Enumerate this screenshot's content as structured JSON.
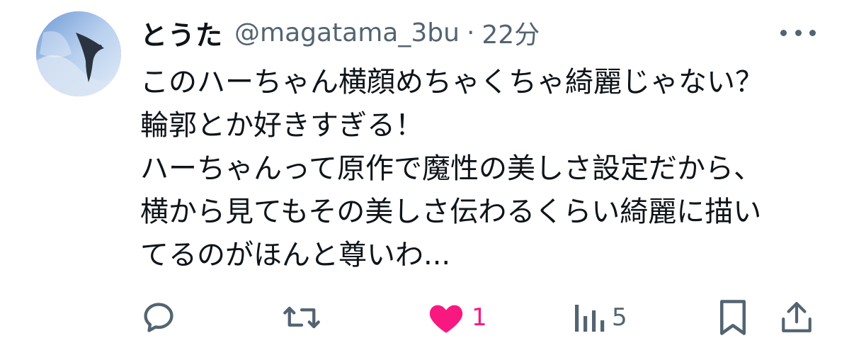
{
  "tweet": {
    "author": {
      "display_name": "とうた",
      "handle": "@magatama_3bu"
    },
    "separator": "·",
    "timestamp": "22分",
    "text_lines": [
      "このハーちゃん横顔めちゃくちゃ綺麗じゃない？",
      "輪郭とか好きすぎる！",
      "ハーちゃんって原作で魔性の美しさ設定だから、",
      "横から見てもその美しさ伝わるくらい綺麗に描い",
      "てるのがほんと尊いわ..."
    ],
    "actions": {
      "reply": {
        "icon": "reply-icon"
      },
      "retweet": {
        "icon": "retweet-icon"
      },
      "like": {
        "icon": "heart-icon",
        "count": "1",
        "liked": true
      },
      "views": {
        "icon": "views-icon",
        "count": "5"
      },
      "bookmark": {
        "icon": "bookmark-icon"
      },
      "share": {
        "icon": "share-icon"
      }
    },
    "colors": {
      "text": "#0f1419",
      "secondary": "#536471",
      "like": "#f91880"
    }
  }
}
